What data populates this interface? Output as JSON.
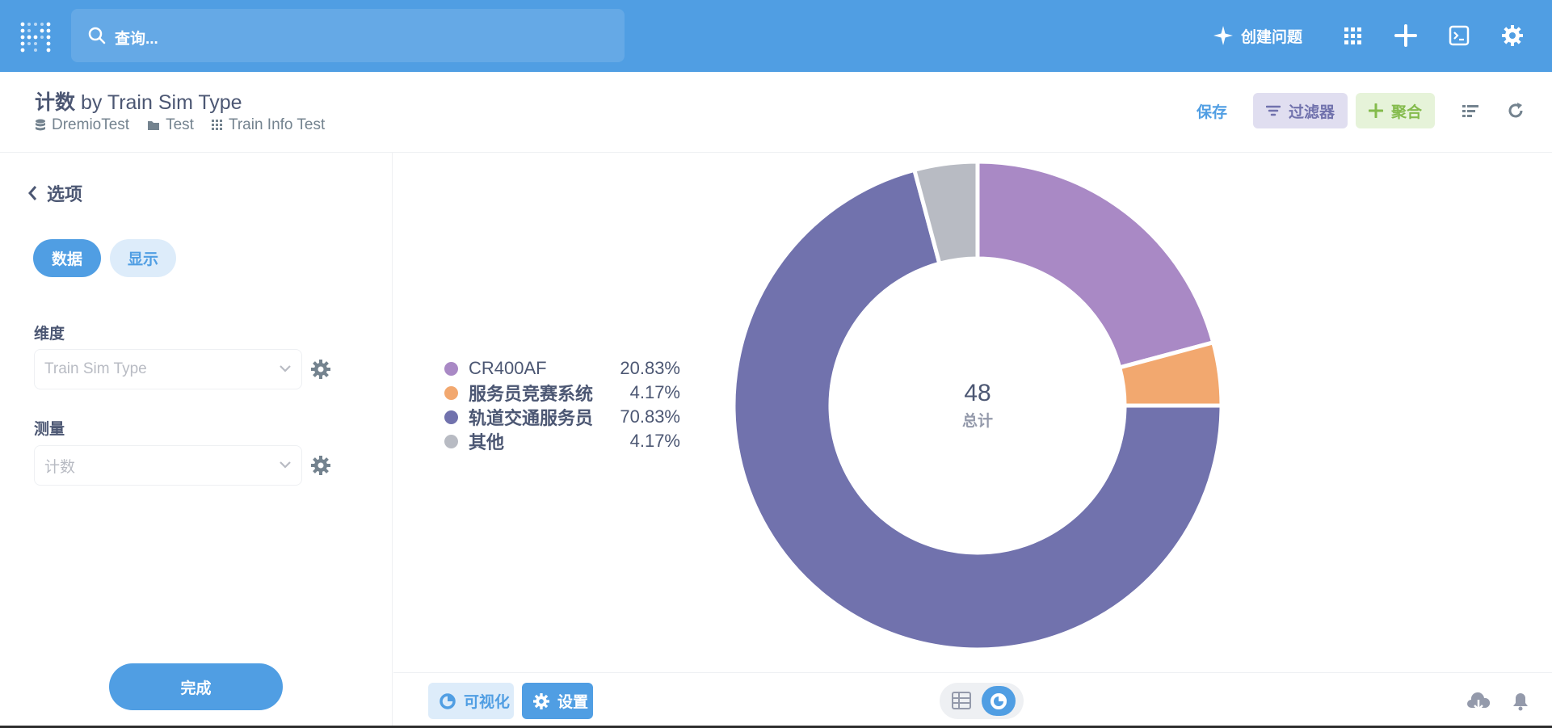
{
  "topnav": {
    "search_placeholder": "查询...",
    "create_question_label": "创建问题",
    "icons": [
      "metabase-logo-icon",
      "search-icon",
      "sparkle-icon",
      "grid-icon",
      "plus-icon",
      "terminal-icon",
      "gear-icon"
    ]
  },
  "header": {
    "title_bold": "计数",
    "title_rest": " by Train Sim Type",
    "breadcrumbs": [
      "DremioTest",
      "Test",
      "Train Info Test"
    ],
    "save_label": "保存",
    "filter_label": "过滤器",
    "summarize_label": "聚合"
  },
  "sidebar": {
    "back_label": "选项",
    "tab_data": "数据",
    "tab_display": "显示",
    "dimension_label": "维度",
    "dimension_value": "Train Sim Type",
    "measure_label": "测量",
    "measure_value": "计数",
    "done_label": "完成"
  },
  "bottombar": {
    "visualization_label": "可视化",
    "settings_label": "设置"
  },
  "chart_data": {
    "type": "pie",
    "donut": true,
    "total": "48",
    "total_label": "总计",
    "legend_position": "left",
    "slices": [
      {
        "name": "CR400AF",
        "percent_label": "20.83%",
        "value": 20.83,
        "color": "#a989c5",
        "bold": false
      },
      {
        "name": "服务员竞赛系统",
        "percent_label": "4.17%",
        "value": 4.17,
        "color": "#f2a86f",
        "bold": true
      },
      {
        "name": "轨道交通服务员",
        "percent_label": "70.83%",
        "value": 70.83,
        "color": "#7172ad",
        "bold": true
      },
      {
        "name": "其他",
        "percent_label": "4.17%",
        "value": 4.17,
        "color": "#b8bbc3",
        "bold": true
      }
    ]
  }
}
